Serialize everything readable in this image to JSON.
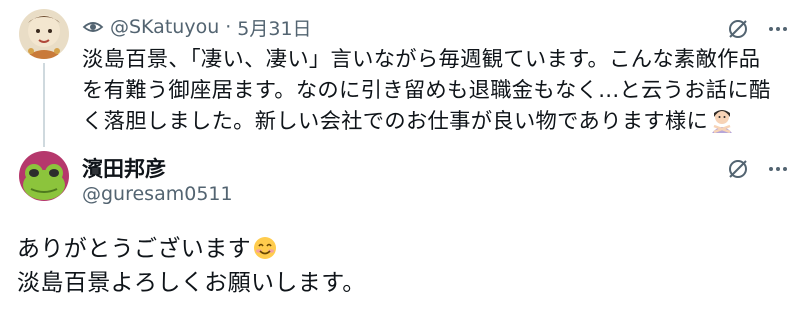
{
  "reply_tweet": {
    "handle": "@SKatuyou",
    "separator": "·",
    "date": "5月31日",
    "text": "淡島百景、「凄い、凄い」言いながら毎週観ています。こんな素敵作品を有難う御座居ます。なのに引き留めも退職金もなく...と云うお話に酷く落胆しました。新しい会社でのお仕事が良い物であります様に",
    "emoji": "person-gesturing-no"
  },
  "author_tweet": {
    "display_name": "濱田邦彦",
    "handle": "@guresam0511",
    "lines": [
      "ありがとうございます",
      "淡島百景よろしくお願いします。"
    ],
    "emoji": "smiling-face-with-smiling-eyes"
  },
  "colors": {
    "text": "#0f1419",
    "secondary": "#536471",
    "thread_line": "#cfd9de",
    "avatar2_bg": "#b5386c",
    "avatar2_frog": "#8cc43c"
  }
}
